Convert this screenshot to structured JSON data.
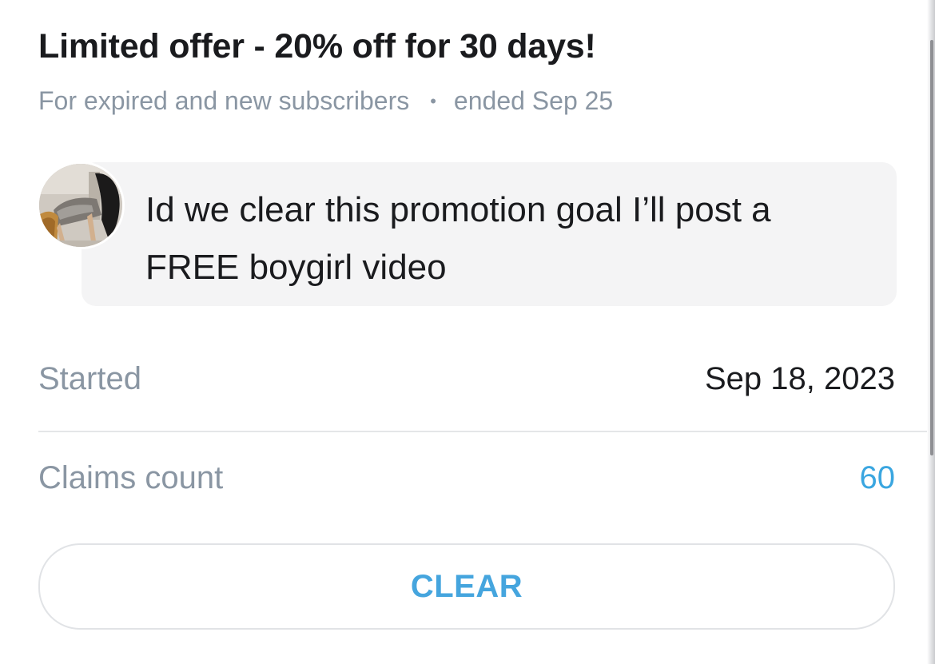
{
  "promotion": {
    "title": "Limited offer - 20% off for 30 days!",
    "audience": "For expired and new subscribers",
    "separator": "•",
    "status": "ended Sep 25",
    "message": "Id we clear this promotion goal I’ll post a FREE boygirl video"
  },
  "details": {
    "started_label": "Started",
    "started_value": "Sep 18, 2023",
    "claims_label": "Claims count",
    "claims_value": "60"
  },
  "actions": {
    "clear_label": "CLEAR"
  },
  "colors": {
    "accent": "#3aa6e0",
    "muted": "#8a96a3",
    "text": "#1a1b1e",
    "message_bg": "#f4f4f5"
  }
}
